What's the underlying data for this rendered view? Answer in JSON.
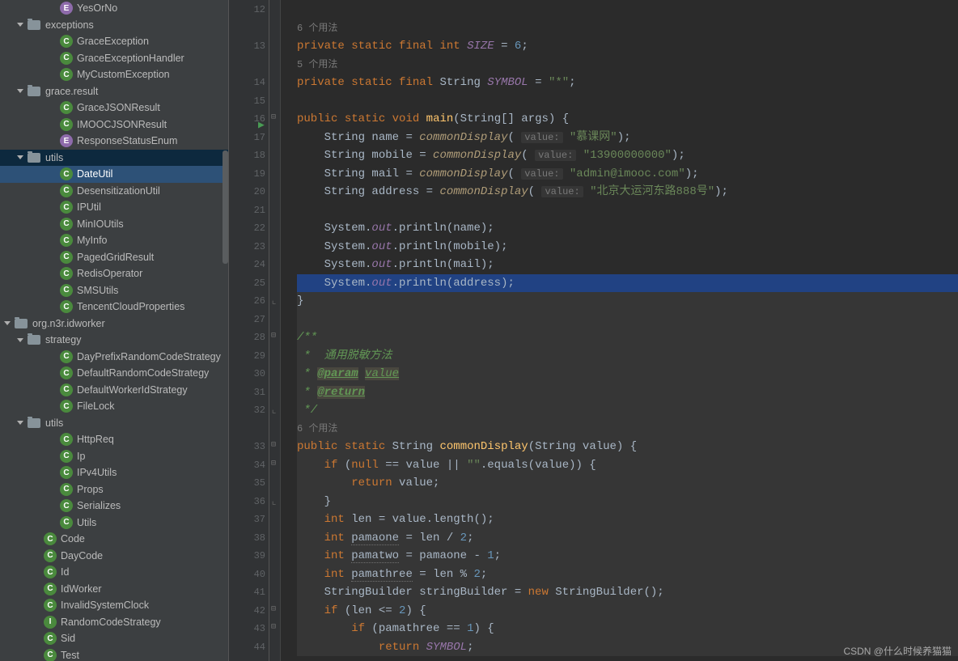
{
  "sidebar": {
    "items": [
      {
        "indent": 60,
        "icon": "c-e",
        "glyph": "E",
        "label": "YesOrNo"
      },
      {
        "indent": 20,
        "arrow": "open",
        "icon": "folder",
        "label": "exceptions"
      },
      {
        "indent": 60,
        "icon": "c-c",
        "glyph": "C",
        "label": "GraceException"
      },
      {
        "indent": 60,
        "icon": "c-c",
        "glyph": "C",
        "label": "GraceExceptionHandler"
      },
      {
        "indent": 60,
        "icon": "c-c",
        "glyph": "C",
        "label": "MyCustomException"
      },
      {
        "indent": 20,
        "arrow": "open",
        "icon": "folder",
        "label": "grace.result"
      },
      {
        "indent": 60,
        "icon": "c-c",
        "glyph": "C",
        "label": "GraceJSONResult"
      },
      {
        "indent": 60,
        "icon": "c-c",
        "glyph": "C",
        "label": "IMOOCJSONResult"
      },
      {
        "indent": 60,
        "icon": "c-e",
        "glyph": "E",
        "label": "ResponseStatusEnum"
      },
      {
        "indent": 20,
        "arrow": "open",
        "icon": "folder",
        "label": "utils",
        "active": true
      },
      {
        "indent": 60,
        "icon": "c-c",
        "glyph": "C",
        "label": "DateUtil",
        "highlight": true
      },
      {
        "indent": 60,
        "icon": "c-c",
        "glyph": "C",
        "label": "DesensitizationUtil"
      },
      {
        "indent": 60,
        "icon": "c-c",
        "glyph": "C",
        "label": "IPUtil"
      },
      {
        "indent": 60,
        "icon": "c-c",
        "glyph": "C",
        "label": "MinIOUtils"
      },
      {
        "indent": 60,
        "icon": "c-c",
        "glyph": "C",
        "label": "MyInfo"
      },
      {
        "indent": 60,
        "icon": "c-c",
        "glyph": "C",
        "label": "PagedGridResult"
      },
      {
        "indent": 60,
        "icon": "c-c",
        "glyph": "C",
        "label": "RedisOperator"
      },
      {
        "indent": 60,
        "icon": "c-c",
        "glyph": "C",
        "label": "SMSUtils"
      },
      {
        "indent": 60,
        "icon": "c-c",
        "glyph": "C",
        "label": "TencentCloudProperties"
      },
      {
        "indent": 4,
        "arrow": "open",
        "icon": "folder",
        "label": "org.n3r.idworker"
      },
      {
        "indent": 20,
        "arrow": "open",
        "icon": "folder",
        "label": "strategy"
      },
      {
        "indent": 60,
        "icon": "c-c",
        "glyph": "C",
        "label": "DayPrefixRandomCodeStrategy"
      },
      {
        "indent": 60,
        "icon": "c-c",
        "glyph": "C",
        "label": "DefaultRandomCodeStrategy"
      },
      {
        "indent": 60,
        "icon": "c-c",
        "glyph": "C",
        "label": "DefaultWorkerIdStrategy"
      },
      {
        "indent": 60,
        "icon": "c-c",
        "glyph": "C",
        "label": "FileLock"
      },
      {
        "indent": 20,
        "arrow": "open",
        "icon": "folder",
        "label": "utils"
      },
      {
        "indent": 60,
        "icon": "c-c",
        "glyph": "C",
        "label": "HttpReq"
      },
      {
        "indent": 60,
        "icon": "c-c",
        "glyph": "C",
        "label": "Ip"
      },
      {
        "indent": 60,
        "icon": "c-c",
        "glyph": "C",
        "label": "IPv4Utils"
      },
      {
        "indent": 60,
        "icon": "c-c",
        "glyph": "C",
        "label": "Props"
      },
      {
        "indent": 60,
        "icon": "c-c",
        "glyph": "C",
        "label": "Serializes"
      },
      {
        "indent": 60,
        "icon": "c-c",
        "glyph": "C",
        "label": "Utils"
      },
      {
        "indent": 40,
        "icon": "c-c",
        "glyph": "C",
        "label": "Code"
      },
      {
        "indent": 40,
        "icon": "c-c",
        "glyph": "C",
        "label": "DayCode"
      },
      {
        "indent": 40,
        "icon": "c-c",
        "glyph": "C",
        "label": "Id"
      },
      {
        "indent": 40,
        "icon": "c-c",
        "glyph": "C",
        "label": "IdWorker"
      },
      {
        "indent": 40,
        "icon": "c-c",
        "glyph": "C",
        "label": "InvalidSystemClock"
      },
      {
        "indent": 40,
        "icon": "c-i",
        "glyph": "I",
        "label": "RandomCodeStrategy"
      },
      {
        "indent": 40,
        "icon": "c-c",
        "glyph": "C",
        "label": "Sid"
      },
      {
        "indent": 40,
        "icon": "c-c",
        "glyph": "C",
        "label": "Test"
      }
    ]
  },
  "editor": {
    "first_line_no": 12,
    "usages6": "6 个用法",
    "usages5": "5 个用法",
    "const_decl_1": {
      "kw1": "private",
      "kw2": "static",
      "kw3": "final",
      "kw4": "int",
      "name": "SIZE",
      "val": "6"
    },
    "const_decl_2": {
      "kw1": "private",
      "kw2": "static",
      "kw3": "final",
      "type": "String",
      "name": "SYMBOL",
      "val": "\"*\""
    },
    "main_sig": {
      "kw1": "public",
      "kw2": "static",
      "kw3": "void",
      "name": "main",
      "params": "(String[] args) {"
    },
    "assigns": [
      {
        "type": "String",
        "var": "name",
        "hint": "value:",
        "val": "\"慕课网\""
      },
      {
        "type": "String",
        "var": "mobile",
        "hint": "value:",
        "val": "\"13900000000\""
      },
      {
        "type": "String",
        "var": "mail",
        "hint": "value:",
        "val": "\"admin@imooc.com\""
      },
      {
        "type": "String",
        "var": "address",
        "hint": "value:",
        "val": "\"北京大运河东路888号\""
      }
    ],
    "prints": [
      "name",
      "mobile",
      "mail",
      "address"
    ],
    "common_call": "commonDisplay",
    "javadoc": {
      "open": "/**",
      "l1": " *  通用脱敏方法",
      "l2p": " * ",
      "param": "@param",
      "paramv": "value",
      "l3p": " * ",
      "ret": "@return",
      "close": " */"
    },
    "common_sig": {
      "kw1": "public",
      "kw2": "static",
      "type": "String",
      "name": "commonDisplay",
      "params": "(String value) {"
    },
    "body": {
      "if1a": "if",
      "if1b": "(",
      "nullkw": "null",
      "eq": " == value || ",
      "emp": "\"\"",
      ".eq": ".equals(value)) {",
      "ret1": "return",
      "retv": " value;",
      "cb": "}",
      "int": "int",
      "len_decl": " len = value.length();",
      "p1": "pamaone",
      "p1r": " = len / ",
      "two": "2",
      "p2": "pamatwo",
      "p2r": " = pamaone - ",
      "one": "1",
      "p3": "pamathree",
      "p3r": " = len % ",
      "sb": "StringBuilder stringBuilder = ",
      "newkw": "new",
      "sb2": " StringBuilder();",
      "if2": "if",
      "if2c": " (len <= ",
      "if2n": "2",
      "if2e": ") {",
      "if3": "if",
      "if3c": " (pamathree == ",
      "if3n": "1",
      "if3e": ") {",
      "ret2": "return",
      "ret2v": "SYMBOL"
    }
  },
  "watermark": "CSDN @什么时候养猫猫"
}
